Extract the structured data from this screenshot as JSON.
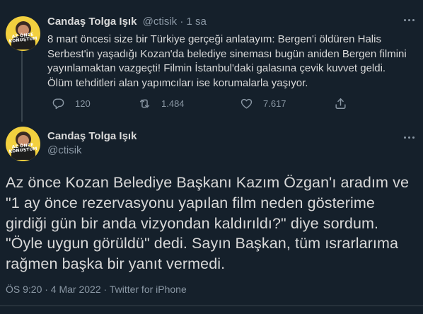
{
  "tweet1": {
    "author_name": "Candaş Tolga Işık",
    "meta": "@ctisik · 1 sa",
    "text": "8 mart öncesi size bir Türkiye gerçeği anlatayım: Bergen'i öldüren Halis Serbest'in yaşadığı Kozan'da belediye sineması bugün aniden Bergen filmini yayınlamaktan vazgeçti! Filmin İstanbul'daki galasına çevik kuvvet geldi. Ölüm tehditleri alan yapımcıları ise korumalarla yaşıyor.",
    "replies": "120",
    "retweets": "1.484",
    "likes": "7.617",
    "avatar_logo_line1": "AZ ÖNCE",
    "avatar_logo_line2": "KONUŞTUM"
  },
  "tweet2": {
    "author_name": "Candaş Tolga Işık",
    "handle": "@ctisik",
    "text": "Az önce Kozan Belediye Başkanı Kazım Özgan'ı aradım ve \"1 ay önce rezervasyonu yapılan film neden gösterime girdiği gün bir anda vizyondan kaldırıldı?\" diye sordum. \"Öyle uygun görüldü\" dedi. Sayın Başkan, tüm ısrarlarıma rağmen başka bir yanıt vermedi.",
    "timestamp": "ÖS 9:20 · 4 Mar 2022 · Twitter for iPhone"
  },
  "colors": {
    "background": "#15202b",
    "text": "#d9d9d9",
    "secondary": "#8b98a5",
    "border": "#38444d",
    "avatar_bg": "#f2d03f"
  },
  "icons": [
    "reply-icon",
    "retweet-icon",
    "like-icon",
    "share-icon",
    "more-icon"
  ]
}
